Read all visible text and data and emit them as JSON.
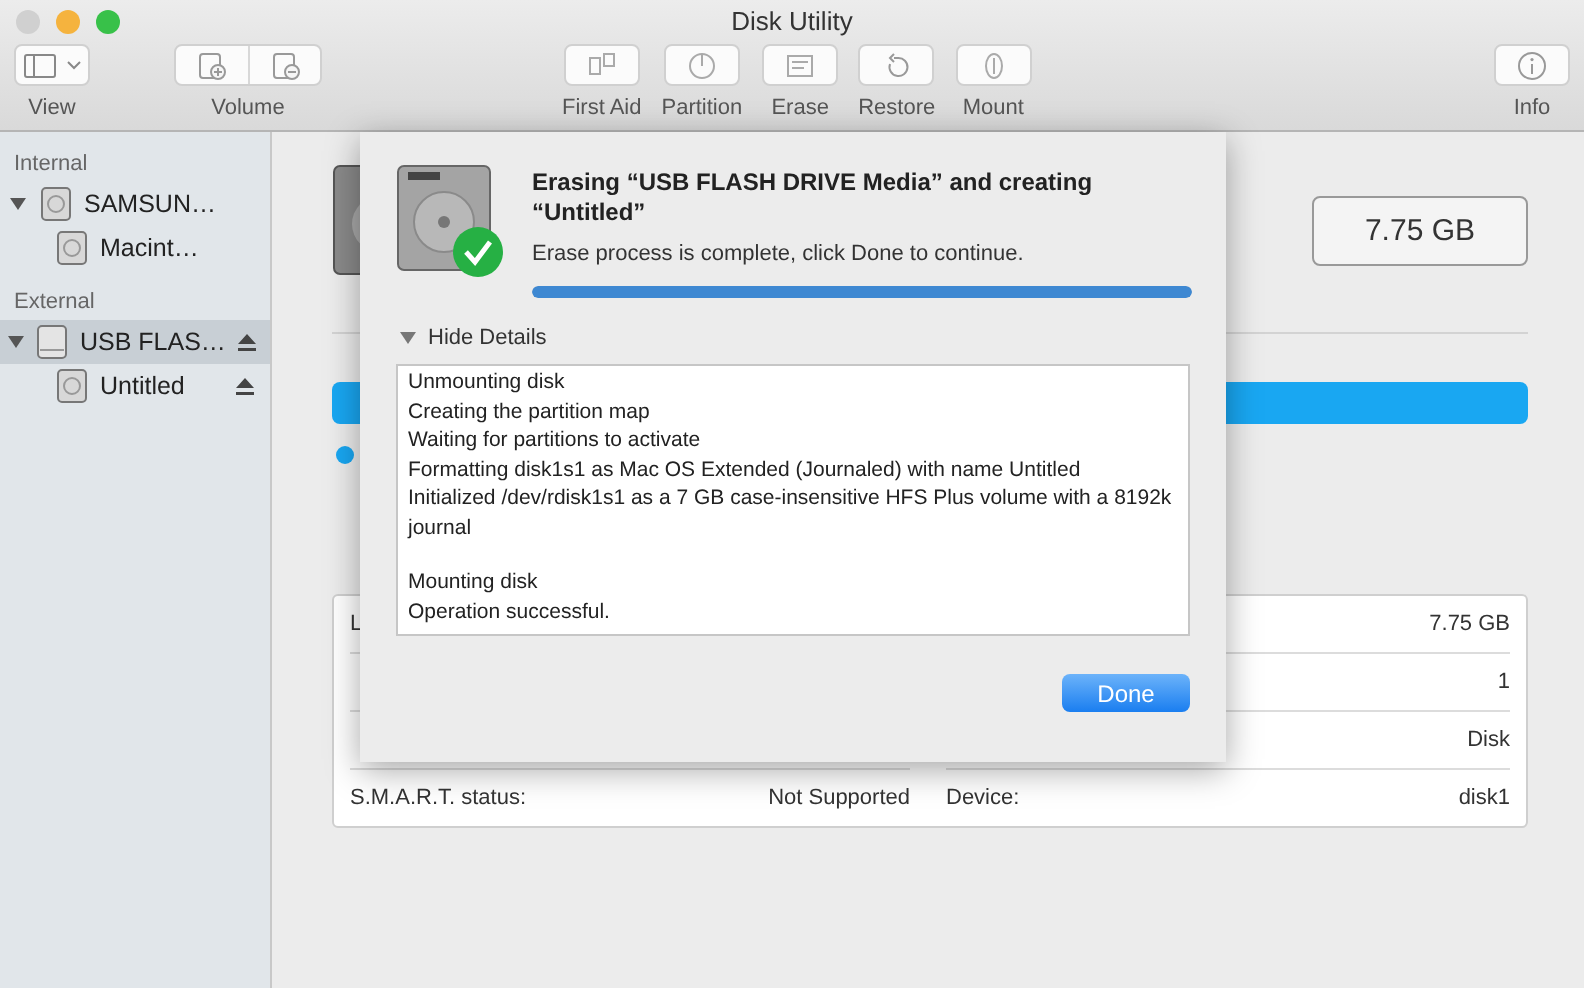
{
  "window": {
    "title": "Disk Utility"
  },
  "toolbar": {
    "groups": [
      {
        "label": "View",
        "kind": "view"
      },
      {
        "label": "Volume",
        "kind": "volume"
      },
      {
        "label": "First Aid",
        "kind": "firstaid"
      },
      {
        "label": "Partition",
        "kind": "partition"
      },
      {
        "label": "Erase",
        "kind": "erase"
      },
      {
        "label": "Restore",
        "kind": "restore"
      },
      {
        "label": "Mount",
        "kind": "mount"
      },
      {
        "label": "Info",
        "kind": "info"
      }
    ]
  },
  "sidebar": {
    "sections": [
      {
        "heading": "Internal",
        "items": [
          {
            "label": "SAMSUN…",
            "selected": false,
            "expanded": true,
            "eject": false,
            "children": [
              {
                "label": "Macint…",
                "selected": false,
                "eject": false
              }
            ]
          }
        ]
      },
      {
        "heading": "External",
        "items": [
          {
            "label": "USB FLAS…",
            "selected": true,
            "expanded": true,
            "eject": true,
            "children": [
              {
                "label": "Untitled",
                "selected": false,
                "eject": true
              }
            ]
          }
        ]
      }
    ]
  },
  "main": {
    "capacity": "7.75 GB",
    "info_rows": [
      {
        "left_label": "L",
        "right_value": "7.75 GB"
      },
      {
        "right_value": "1"
      },
      {
        "right_value": "Disk"
      },
      {
        "left_label": "S.M.A.R.T. status:",
        "left_value": "Not Supported",
        "right_label": "Device:",
        "right_value": "disk1"
      }
    ]
  },
  "dialog": {
    "title": "Erasing “USB FLASH DRIVE Media” and creating “Untitled”",
    "message": "Erase process is complete, click Done to continue.",
    "progress": {
      "level": 1
    },
    "details": {
      "label": "Hide Details",
      "expanded": true
    },
    "log_blocks": [
      {
        "lines": [
          "Unmounting disk",
          "Creating the partition map",
          "Waiting for partitions to activate",
          "Formatting disk1s1 as Mac OS Extended (Journaled) with name Untitled",
          "Initialized /dev/rdisk1s1 as a 7 GB case-insensitive HFS Plus volume with a 8192k journal"
        ]
      },
      {
        "lines": [
          "Mounting disk",
          "Operation successful."
        ]
      }
    ],
    "button": "Done"
  }
}
